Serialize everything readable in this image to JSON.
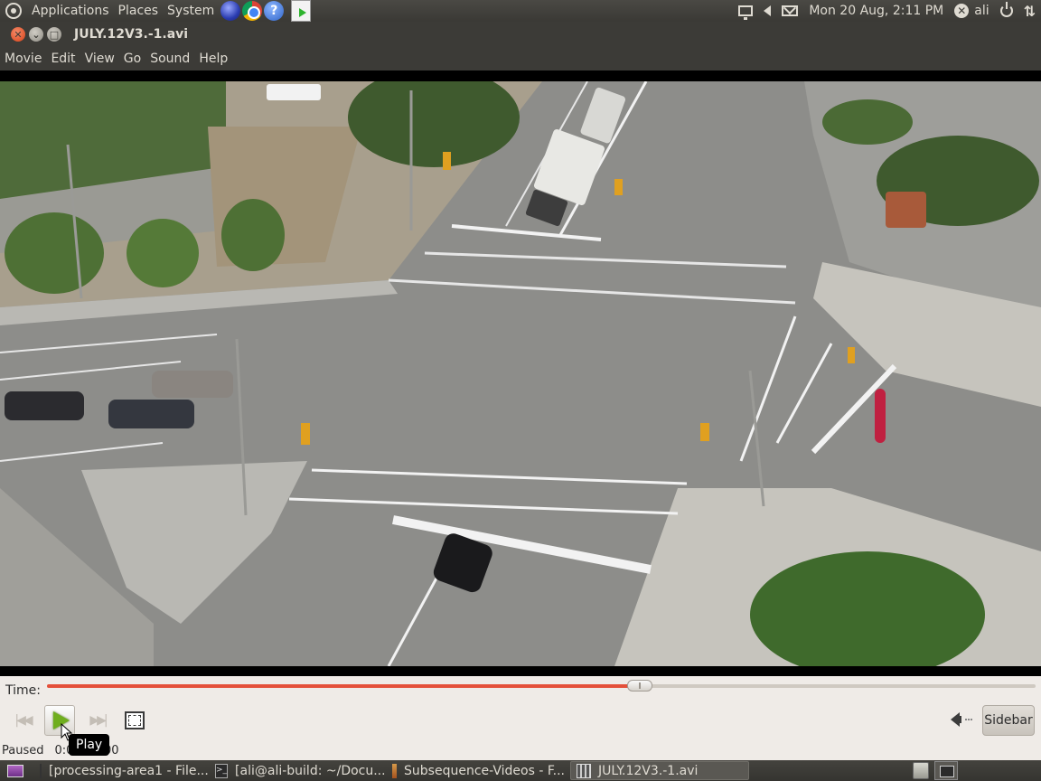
{
  "top_panel": {
    "menus": [
      "Applications",
      "Places",
      "System"
    ],
    "clock": "Mon 20 Aug,  2:11 PM",
    "user": "ali"
  },
  "window": {
    "title": "JULY.12V3.-1.avi",
    "menubar": [
      "Movie",
      "Edit",
      "View",
      "Go",
      "Sound",
      "Help"
    ]
  },
  "controls": {
    "time_label": "Time:",
    "seek_fraction": 0.6,
    "sidebar_label": "Sidebar",
    "status": "Paused",
    "time_display": "0:00 / 0:00",
    "tooltip": "Play"
  },
  "taskbar": {
    "tasks": [
      {
        "label": "[processing-area1 - File..."
      },
      {
        "label": "[ali@ali-build: ~/Docu..."
      },
      {
        "label": "Subsequence-Videos - F..."
      },
      {
        "label": "JULY.12V3.-1.avi"
      }
    ]
  }
}
